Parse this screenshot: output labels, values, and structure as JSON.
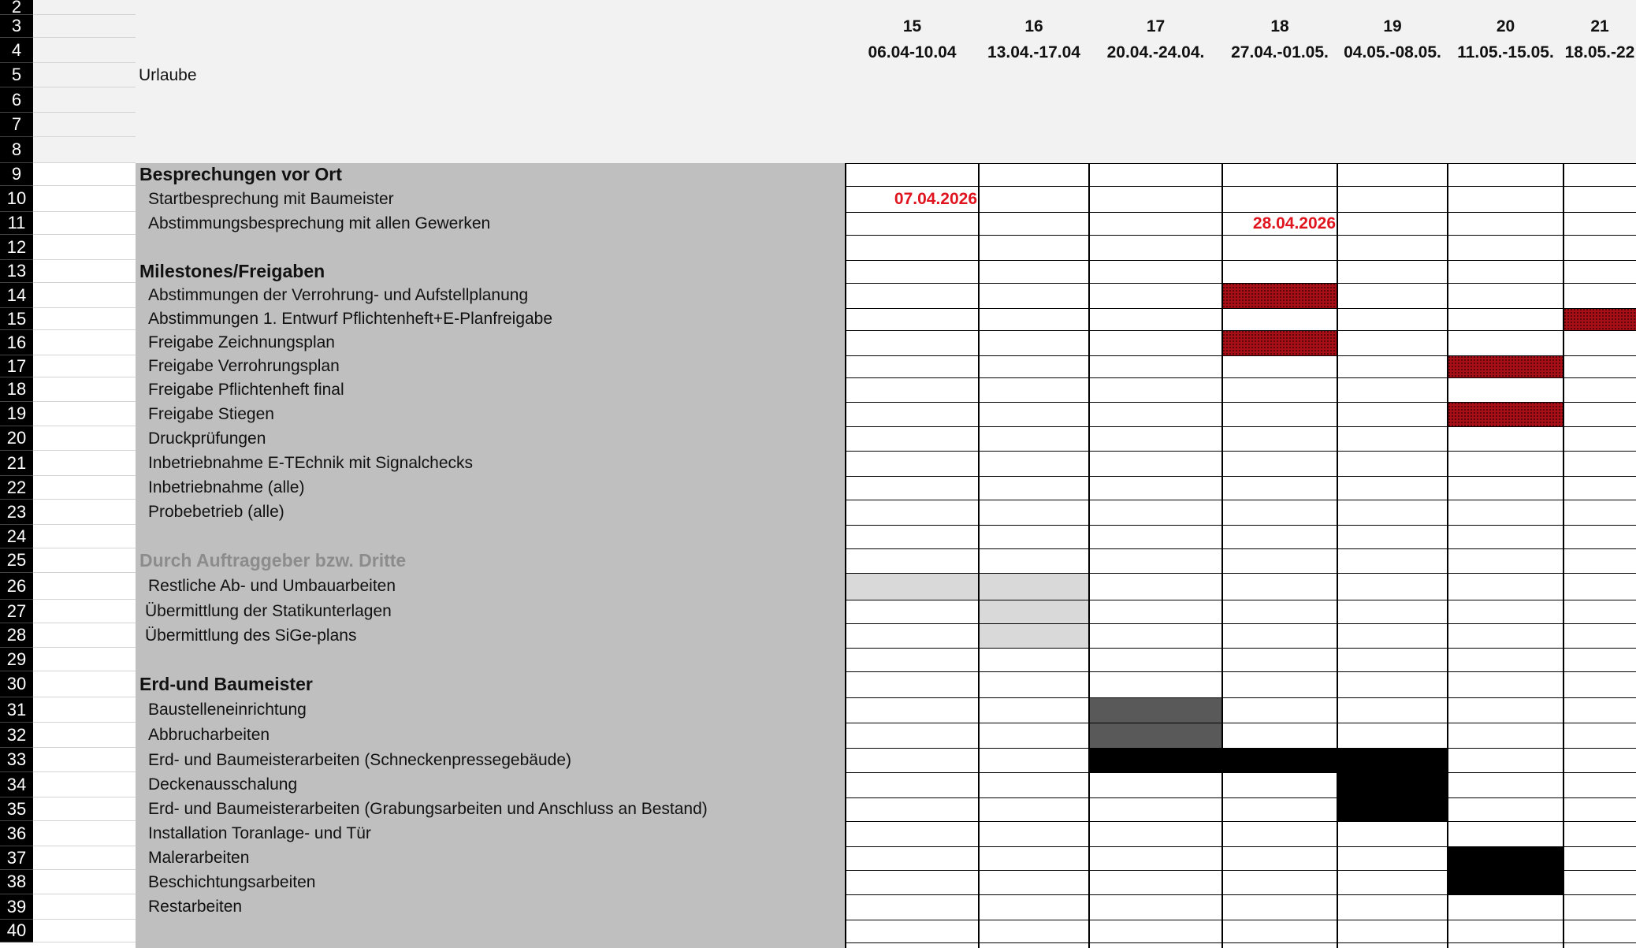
{
  "sheet": {
    "vacation_label": "Urlaube",
    "weeks": [
      {
        "num": "15",
        "range": "06.04-10.04"
      },
      {
        "num": "16",
        "range": "13.04.-17.04"
      },
      {
        "num": "17",
        "range": "20.04.-24.04."
      },
      {
        "num": "18",
        "range": "27.04.-01.05."
      },
      {
        "num": "19",
        "range": "04.05.-08.05."
      },
      {
        "num": "20",
        "range": "11.05.-15.05."
      },
      {
        "num": "21",
        "range": "18.05.-22"
      }
    ],
    "rows": [
      {
        "n": "2",
        "label": "",
        "type": ""
      },
      {
        "n": "3",
        "label": "",
        "type": ""
      },
      {
        "n": "4",
        "label": "",
        "type": ""
      },
      {
        "n": "5",
        "label": "",
        "type": ""
      },
      {
        "n": "6",
        "label": "",
        "type": ""
      },
      {
        "n": "7",
        "label": "",
        "type": ""
      },
      {
        "n": "8",
        "label": "",
        "type": ""
      },
      {
        "n": "9",
        "label": "Besprechungen vor Ort",
        "type": "header"
      },
      {
        "n": "10",
        "label": "Startbesprechung mit Baumeister",
        "type": "task"
      },
      {
        "n": "11",
        "label": "Abstimmungsbesprechung mit allen Gewerken",
        "type": "task"
      },
      {
        "n": "12",
        "label": "",
        "type": "task"
      },
      {
        "n": "13",
        "label": "Milestones/Freigaben",
        "type": "header"
      },
      {
        "n": "14",
        "label": "Abstimmungen der Verrohrung- und Aufstellplanung",
        "type": "task"
      },
      {
        "n": "15",
        "label": "Abstimmungen 1. Entwurf Pflichtenheft+E-Planfreigabe",
        "type": "task"
      },
      {
        "n": "16",
        "label": "Freigabe Zeichnungsplan",
        "type": "task"
      },
      {
        "n": "17",
        "label": "Freigabe Verrohrungsplan",
        "type": "task"
      },
      {
        "n": "18",
        "label": "Freigabe Pflichtenheft final",
        "type": "task"
      },
      {
        "n": "19",
        "label": "Freigabe Stiegen",
        "type": "task"
      },
      {
        "n": "20",
        "label": "Druckprüfungen",
        "type": "task"
      },
      {
        "n": "21",
        "label": "Inbetriebnahme E-TEchnik mit Signalchecks",
        "type": "task"
      },
      {
        "n": "22",
        "label": "Inbetriebnahme (alle)",
        "type": "task"
      },
      {
        "n": "23",
        "label": "Probebetrieb (alle)",
        "type": "task"
      },
      {
        "n": "24",
        "label": "",
        "type": "task"
      },
      {
        "n": "25",
        "label": "Durch Auftraggeber bzw. Dritte",
        "type": "header-grey"
      },
      {
        "n": "26",
        "label": "Restliche Ab- und Umbauarbeiten",
        "type": "task"
      },
      {
        "n": "27",
        "label": "Übermittlung der Statikunterlagen",
        "type": "task2"
      },
      {
        "n": "28",
        "label": "Übermittlung des SiGe-plans",
        "type": "task2"
      },
      {
        "n": "29",
        "label": "",
        "type": "task"
      },
      {
        "n": "30",
        "label": "Erd-und Baumeister",
        "type": "header"
      },
      {
        "n": "31",
        "label": "Baustelleneinrichtung",
        "type": "task"
      },
      {
        "n": "32",
        "label": "Abbrucharbeiten",
        "type": "task"
      },
      {
        "n": "33",
        "label": "Erd- und Baumeisterarbeiten (Schneckenpressegebäude)",
        "type": "task"
      },
      {
        "n": "34",
        "label": "Deckenausschalung",
        "type": "task"
      },
      {
        "n": "35",
        "label": "Erd- und Baumeisterarbeiten (Grabungsarbeiten und Anschluss an Bestand)",
        "type": "task"
      },
      {
        "n": "36",
        "label": "Installation Toranlage- und Tür",
        "type": "task"
      },
      {
        "n": "37",
        "label": "Malerarbeiten",
        "type": "task"
      },
      {
        "n": "38",
        "label": "Beschichtungsarbeiten",
        "type": "task"
      },
      {
        "n": "39",
        "label": "Restarbeiten",
        "type": "task"
      },
      {
        "n": "40",
        "label": "",
        "type": "task"
      }
    ],
    "dates": [
      {
        "row": "10",
        "week": 0,
        "text": "07.04.2026"
      },
      {
        "row": "11",
        "week": 3,
        "text": "28.04.2026"
      }
    ],
    "bars": [
      {
        "row": "14",
        "from": 3,
        "to": 3,
        "style": "red"
      },
      {
        "row": "15",
        "from": 6,
        "to": 6,
        "style": "red"
      },
      {
        "row": "16",
        "from": 3,
        "to": 3,
        "style": "red"
      },
      {
        "row": "17",
        "from": 5,
        "to": 5,
        "style": "red"
      },
      {
        "row": "19",
        "from": 5,
        "to": 5,
        "style": "red"
      },
      {
        "row": "26",
        "from": 0,
        "to": 1,
        "style": "lightgrey"
      },
      {
        "row": "27",
        "from": 1,
        "to": 1,
        "style": "lightgrey"
      },
      {
        "row": "28",
        "from": 1,
        "to": 1,
        "style": "lightgrey"
      },
      {
        "row": "31",
        "from": 2,
        "to": 2,
        "style": "darkgrey"
      },
      {
        "row": "32",
        "from": 2,
        "to": 2,
        "style": "darkgrey"
      },
      {
        "row": "33",
        "from": 2,
        "to": 4,
        "style": "black"
      },
      {
        "row": "34",
        "from": 4,
        "to": 4,
        "style": "black"
      },
      {
        "row": "35",
        "from": 4,
        "to": 4,
        "style": "black"
      },
      {
        "row": "37",
        "from": 5,
        "to": 5,
        "style": "black"
      },
      {
        "row": "38",
        "from": 5,
        "to": 5,
        "style": "black"
      }
    ],
    "colors": {
      "header_bg": "#f2f2f2",
      "task_area_bg": "#bfbfbf",
      "row_header_bg": "#000000",
      "date_text": "#e0141e",
      "milestone_red": "#a80f17",
      "light_grey_bar": "#d9d9d9",
      "dark_grey_bar": "#595959",
      "black_bar": "#000000",
      "grey_header_text": "#8c8c8c"
    }
  }
}
